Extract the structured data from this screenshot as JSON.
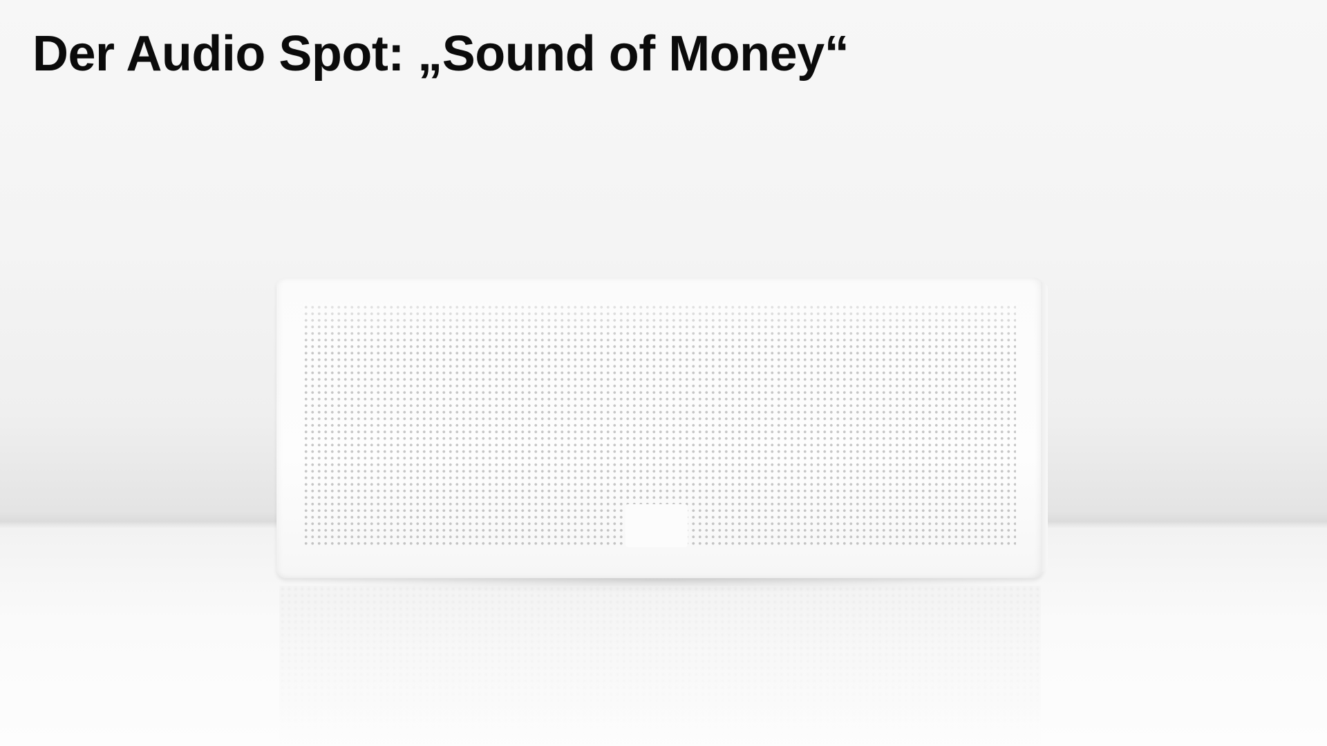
{
  "slide": {
    "title": "Der Audio Spot: „Sound of Money“"
  },
  "photo": {
    "subject_icon": "speaker-icon",
    "background_color": "#f5f5f5",
    "speaker_color": "#fcfcfc",
    "grille_dot_color": "#8a8a8a"
  }
}
